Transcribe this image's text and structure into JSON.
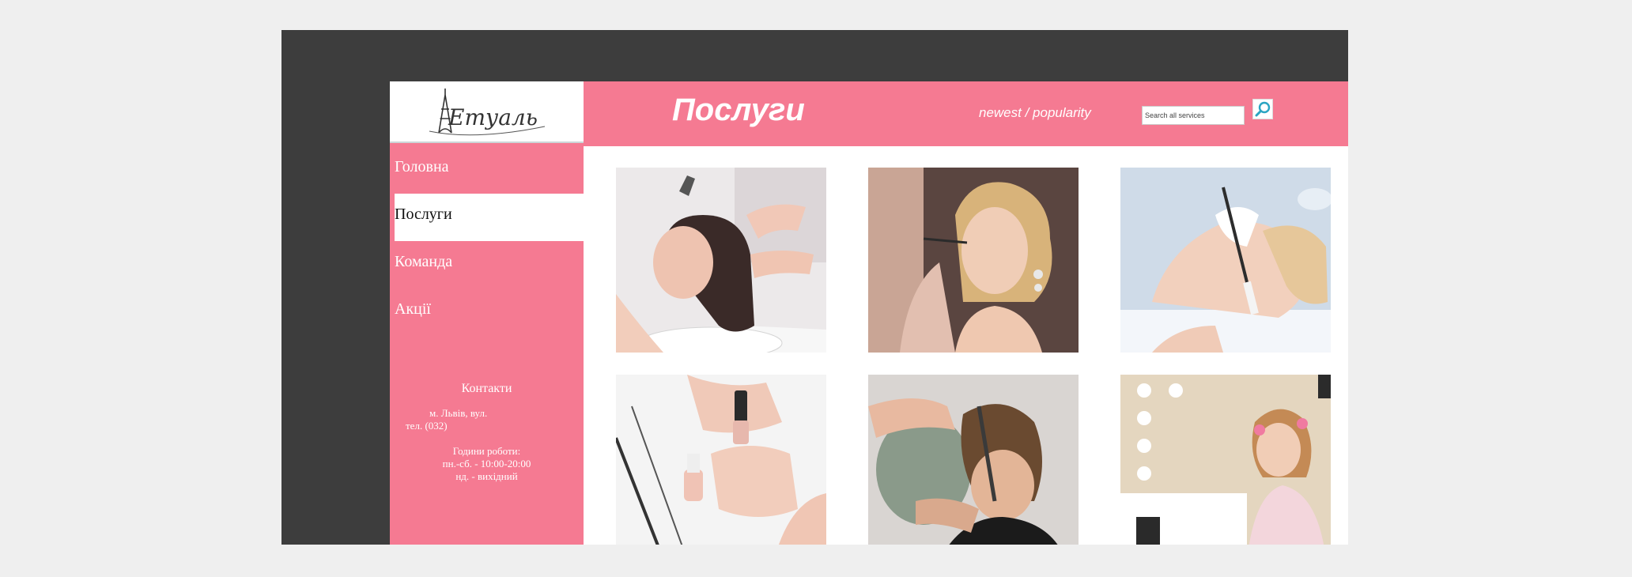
{
  "logo": {
    "text": "Етуаль"
  },
  "nav": {
    "items": [
      {
        "label": "Головна"
      },
      {
        "label": "Послуги"
      },
      {
        "label": "Команда"
      },
      {
        "label": "Акції"
      }
    ],
    "active": "Послуги"
  },
  "contacts": {
    "title": "Контакти",
    "address_line1": "м. Львів, вул.",
    "address_line2": "тел. (032)",
    "hours_title": "Години роботи:",
    "hours_weekdays": "пн.-сб. - 10:00-20:00",
    "hours_sunday": "нд. - вихідний"
  },
  "header": {
    "title": "Послуги",
    "sort_newest": "newest",
    "sort_separator": " / ",
    "sort_popularity": "popularity"
  },
  "search": {
    "placeholder": "Search all services",
    "value": ""
  },
  "gallery": {
    "tiles": [
      {
        "icon": "hair-wash-photo"
      },
      {
        "icon": "makeup-photo"
      },
      {
        "icon": "facial-mask-photo"
      },
      {
        "icon": "manicure-photo"
      },
      {
        "icon": "haircut-photo"
      },
      {
        "icon": "kids-beauty-photo"
      }
    ]
  },
  "colors": {
    "accent_pink": "#f57a92",
    "frame_dark": "#3d3d3d",
    "background": "#efefef"
  }
}
